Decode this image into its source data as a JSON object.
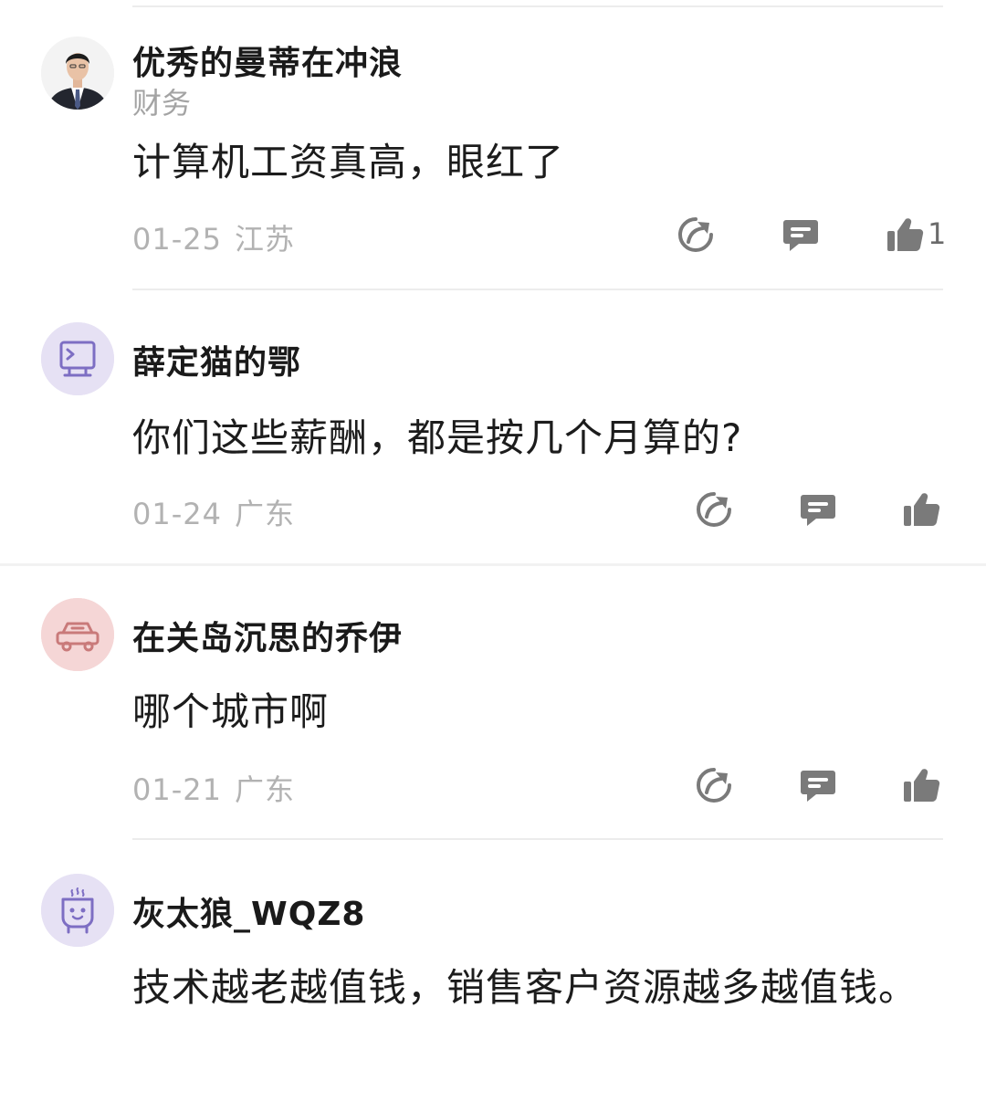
{
  "comments": [
    {
      "user": "优秀的曼蒂在冲浪",
      "role": "财务",
      "text": "计算机工资真高，眼红了",
      "date": "01-25",
      "location": "江苏",
      "likes": "1",
      "avatar_bg": "#f4f4f4"
    },
    {
      "user": "薛定猫的鄂",
      "text": "你们这些薪酬，都是按几个月算的?",
      "date": "01-24",
      "location": "广东",
      "avatar_bg": "#e6e1f4",
      "avatar_icon": "terminal-icon"
    },
    {
      "user": "在关岛沉思的乔伊",
      "text": "哪个城市啊",
      "date": "01-21",
      "location": "广东",
      "avatar_bg": "#f5d6d6",
      "avatar_icon": "car-icon"
    },
    {
      "user": "灰太狼_WQZ8",
      "text": "技术越老越值钱，销售客户资源越多越值钱。",
      "avatar_bg": "#e6e1f4",
      "avatar_icon": "robot-icon"
    }
  ],
  "action_icons": [
    "share-icon",
    "reply-icon",
    "like-icon"
  ],
  "colors": {
    "text": "#1c1c1c",
    "meta": "#b2b2b2",
    "icon": "#7a7a7a",
    "avatar_purple": "#7d6ec3",
    "avatar_red": "#c97a7a"
  }
}
